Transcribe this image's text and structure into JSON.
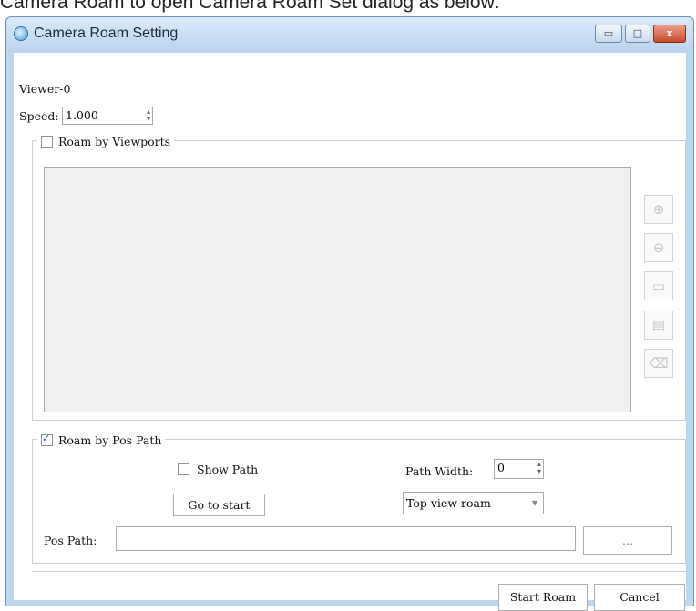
{
  "caption": "Camera Roam to open Camera Roam Set dialog as below:",
  "window": {
    "title": "Camera Roam Setting",
    "minimize_glyph": "▭",
    "maximize_glyph": "□",
    "close_glyph": "x"
  },
  "viewer": {
    "label": "Viewer-0"
  },
  "speed": {
    "label": "Speed:",
    "value": "1.000"
  },
  "roam_viewports": {
    "label": "Roam by Viewports",
    "checked": false,
    "side_buttons": [
      {
        "icon": "add-icon",
        "glyph": "⊕"
      },
      {
        "icon": "remove-icon",
        "glyph": "⊖"
      },
      {
        "icon": "folder-icon",
        "glyph": "▭"
      },
      {
        "icon": "save-icon",
        "glyph": "▤"
      },
      {
        "icon": "delete-icon",
        "glyph": "⌫"
      }
    ]
  },
  "roam_pos_path": {
    "label": "Roam by Pos Path",
    "checked": true,
    "check_glyph": "✓",
    "show_path_label": "Show Path",
    "path_width_label": "Path Width:",
    "path_width_value": "0",
    "go_to_start_label": "Go to start",
    "view_mode_value": "Top view roam",
    "pos_path_label": "Pos Path:",
    "pos_path_value": "",
    "browse_label": "..."
  },
  "footer": {
    "start_label": "Start Roam",
    "cancel_label": "Cancel"
  },
  "colors": {
    "frame": "#bfd7ee",
    "close_button": "#c84a2e",
    "check_accent": "#2c5aa0"
  }
}
